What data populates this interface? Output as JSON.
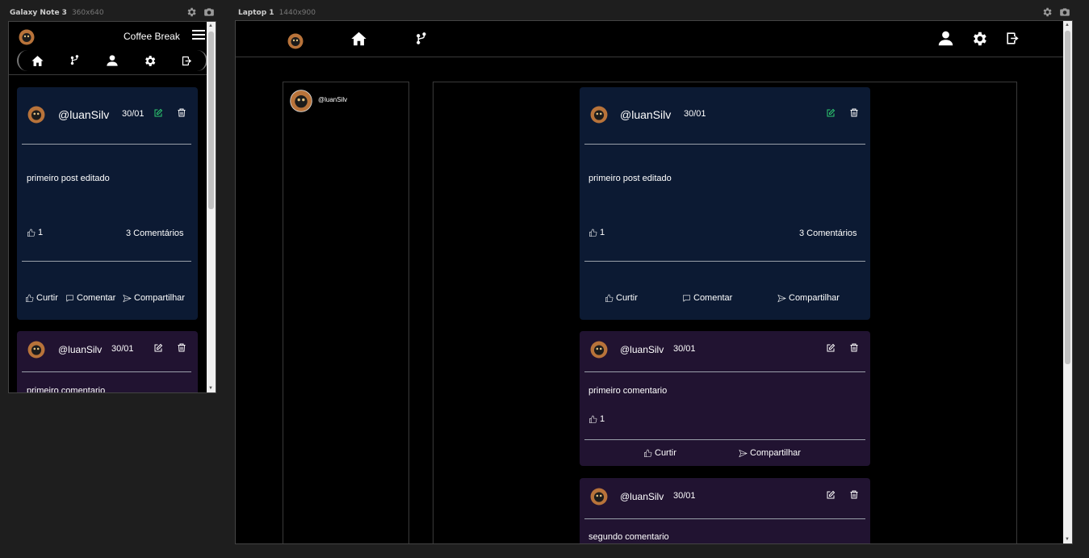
{
  "devices": [
    {
      "name": "Galaxy Note 3",
      "size": "360x640"
    },
    {
      "name": "Laptop 1",
      "size": "1440x900"
    }
  ],
  "app": {
    "brand": "Coffee Break"
  },
  "profile": {
    "handle": "@luanSilv"
  },
  "post": {
    "user": "@luanSilv",
    "date": "30/01",
    "text": "primeiro post editado",
    "likes": "1",
    "comments": "3 Comentários",
    "actions": {
      "like": "Curtir",
      "comment": "Comentar",
      "share": "Compartilhar"
    }
  },
  "comments": [
    {
      "user": "@luanSilv",
      "date": "30/01",
      "text": "primeiro comentario",
      "likes": "1",
      "actions": {
        "like": "Curtir",
        "share": "Compartilhar"
      }
    },
    {
      "user": "@luanSilv",
      "date": "30/01",
      "text": "segundo comentario"
    }
  ],
  "colors": {
    "post_bg": "#0c1a33",
    "comment_bg": "#211331",
    "edit_active": "#2ecc71",
    "avatar": "#b8733a"
  }
}
